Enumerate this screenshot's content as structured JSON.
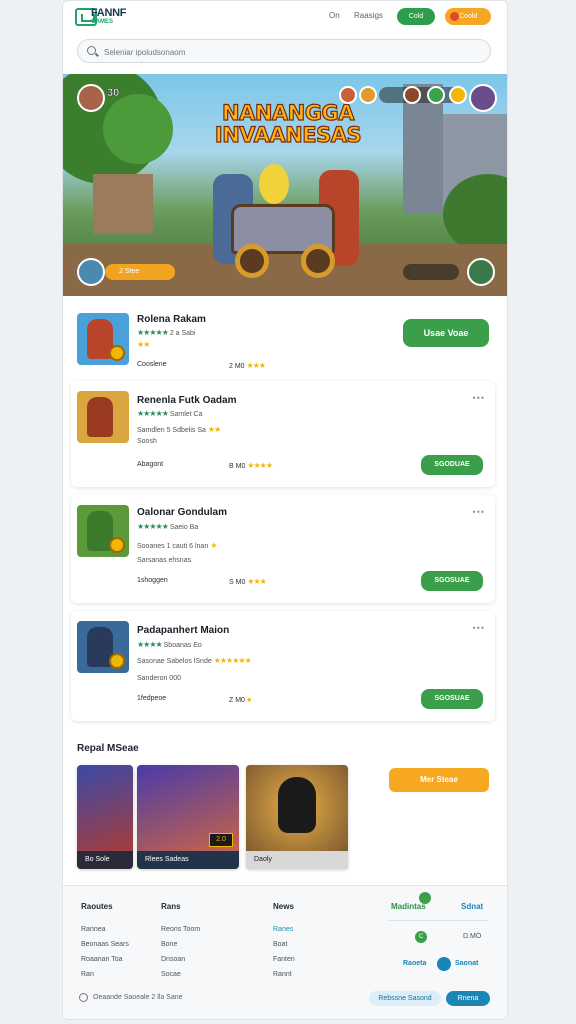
{
  "header": {
    "brand": "FANNF",
    "brand_sub": "GAMES",
    "link1": "On",
    "link2": "Raasigs",
    "btn_green": "Cold",
    "btn_orange": "Coold"
  },
  "search": {
    "placeholder": "Seleniar ipoludsonaom"
  },
  "hero": {
    "title": "NANANGGA INVAANESAS",
    "level": "30",
    "pill": "2 Stee"
  },
  "games": [
    {
      "title": "Rolena Rakam",
      "line1": "2 a Sabi",
      "line2": "",
      "meta": "Cooslene",
      "price": "2 M0",
      "button": "Usae Voae"
    },
    {
      "title": "Renenla Futk Oadam",
      "line1": "Samlet Ca",
      "line2": "Samdlen 5 Sdbelis Sa",
      "line3": "Soosh",
      "meta": "Abagont",
      "price": "B M0",
      "button": "SGODUAE"
    },
    {
      "title": "Oalonar Gondulam",
      "line1": "Saeio Ba",
      "line2": "Sooanes 1 cauti 6 lnan",
      "line3": "Sarsanas ehsnas",
      "meta": "1shoggen",
      "price": "S M0",
      "button": "SGOSUAE"
    },
    {
      "title": "Padapanhert Maion",
      "line1": "Sboanas Eo",
      "line2": "Sasonae Sabelos lSnde",
      "line3": "Sanderon 000",
      "meta": "1fedpeoe",
      "price": "Z M0",
      "button": "SGOSUAE"
    }
  ],
  "recent": {
    "title": "Repal MSeae",
    "items": [
      {
        "caption": "Bo  Sole"
      },
      {
        "caption": "Rlees Sadeas",
        "badge": "2.0"
      },
      {
        "caption": "Daoly"
      }
    ],
    "button": "Mer Steae"
  },
  "footer": {
    "cols": [
      {
        "head": "Raoutes",
        "items": [
          "Rannea",
          "Beonaas Sears",
          "Roaanan Toa",
          "Ran"
        ]
      },
      {
        "head": "Rans",
        "items": [
          "Reons Toom",
          "Bone",
          "Dnsoan",
          "Socae"
        ]
      },
      {
        "head": "News",
        "items": [
          "Ranes",
          "Boat",
          "Fanten",
          "Rannt"
        ]
      }
    ],
    "right_head1": "Madintas",
    "right_head2": "Sdnat",
    "right_val1": "C",
    "right_val2": "D.MO",
    "right_link1": "Raoeta",
    "right_link2": "Saonat",
    "copyright": "Oeaande Saoeale 2 lla Sane",
    "btn1": "Rebssne Sasond",
    "btn2": "Rnena"
  },
  "colors": {
    "green": "#3a9e4a",
    "orange": "#f7a821",
    "teal": "#1b86b5"
  }
}
